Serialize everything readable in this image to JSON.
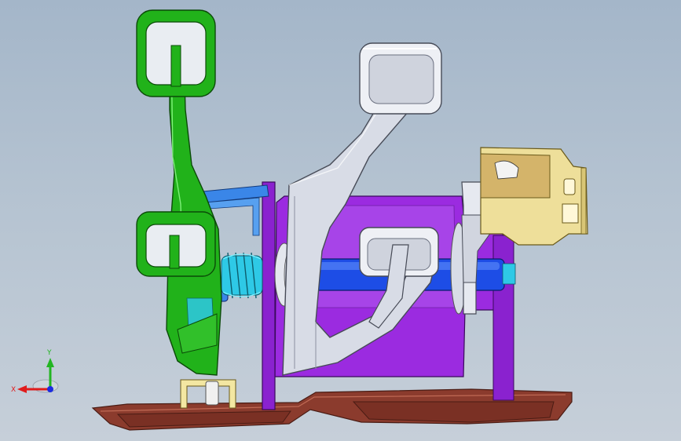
{
  "view": {
    "colors": {
      "background_top": "#a4b6c9",
      "background_bottom": "#c6cfd9",
      "green_pedal": "#21b21a",
      "purple_bracket": "#9b2be0",
      "silver_pedal": "#d8dce6",
      "blue_shaft": "#1d4de6",
      "cyan_spring": "#2ec9e6",
      "brown_base": "#8b3b2d",
      "yellow_bracket": "#eedf9a"
    },
    "triad": {
      "x_label": "X",
      "y_label": "Y",
      "x_color": "#e01c1c",
      "y_color": "#22b522",
      "z_color": "#1c2ce0"
    }
  }
}
